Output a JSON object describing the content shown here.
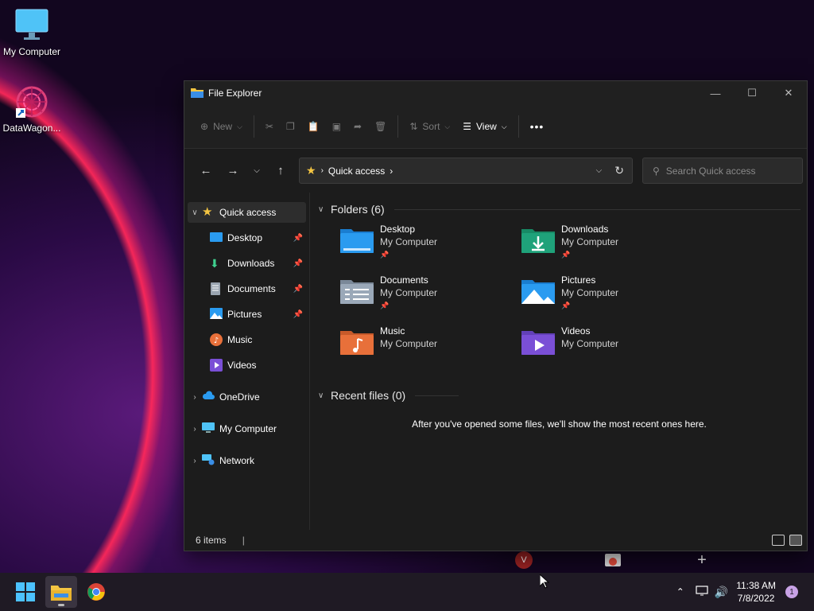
{
  "desktop": {
    "icons": [
      {
        "label": "My Computer",
        "icon": "monitor-icon"
      },
      {
        "label": "DataWagon...",
        "icon": "datawagon-shortcut-icon"
      }
    ]
  },
  "window": {
    "title": "File Explorer",
    "toolbar": {
      "new_label": "New",
      "sort_label": "Sort",
      "view_label": "View",
      "more_label": "•••"
    },
    "address": {
      "crumb": "Quick access"
    },
    "search": {
      "placeholder": "Search Quick access"
    },
    "sidebar": {
      "quick_access": "Quick access",
      "items": [
        {
          "label": "Desktop",
          "pinned": true
        },
        {
          "label": "Downloads",
          "pinned": true
        },
        {
          "label": "Documents",
          "pinned": true
        },
        {
          "label": "Pictures",
          "pinned": true
        },
        {
          "label": "Music",
          "pinned": false
        },
        {
          "label": "Videos",
          "pinned": false
        }
      ],
      "onedrive": "OneDrive",
      "mycomputer": "My Computer",
      "network": "Network"
    },
    "content": {
      "folders_header": "Folders (6)",
      "folders": [
        {
          "name": "Desktop",
          "location": "My Computer",
          "pinned": true
        },
        {
          "name": "Downloads",
          "location": "My Computer",
          "pinned": true
        },
        {
          "name": "Documents",
          "location": "My Computer",
          "pinned": true
        },
        {
          "name": "Pictures",
          "location": "My Computer",
          "pinned": true
        },
        {
          "name": "Music",
          "location": "My Computer",
          "pinned": false
        },
        {
          "name": "Videos",
          "location": "My Computer",
          "pinned": false
        }
      ],
      "recent_header": "Recent files (0)",
      "recent_empty": "After you've opened some files, we'll show the most recent ones here."
    },
    "status": {
      "items": "6 items"
    }
  },
  "taskbar": {
    "time": "11:38 AM",
    "date": "7/8/2022",
    "notification_count": "1"
  },
  "colors": {
    "accent": "#0078d4",
    "folder_blue": "#2a9bf0",
    "folder_green": "#1fa27a",
    "folder_orange": "#e8703a",
    "folder_purple": "#7a4fd6"
  }
}
